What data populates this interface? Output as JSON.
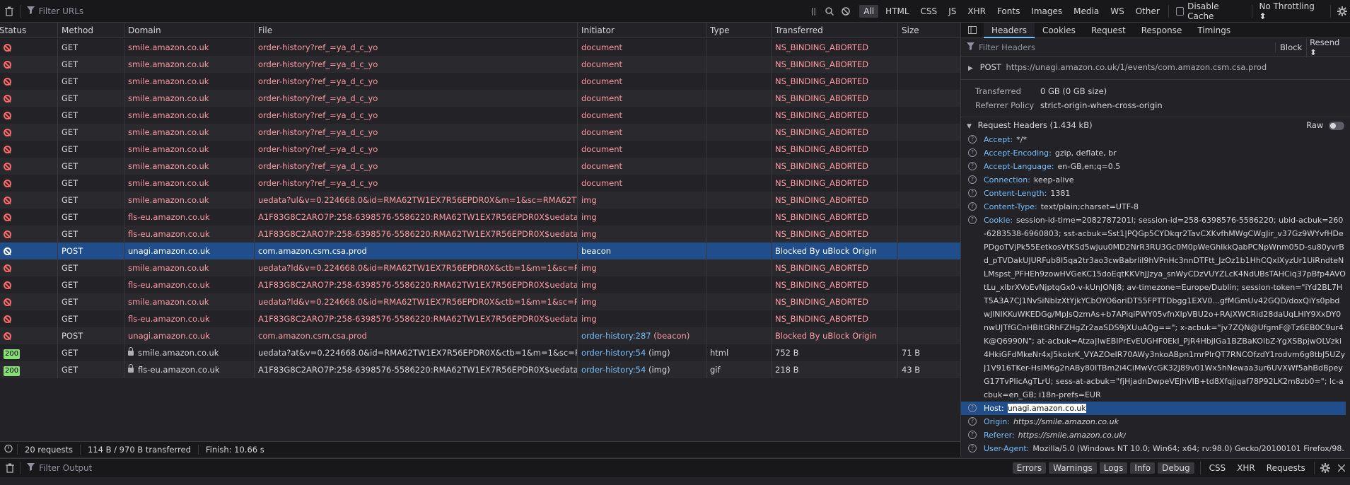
{
  "toolbar": {
    "filter_placeholder": "Filter URLs",
    "types": [
      "All",
      "HTML",
      "CSS",
      "JS",
      "XHR",
      "Fonts",
      "Images",
      "Media",
      "WS",
      "Other"
    ],
    "disable_cache": "Disable Cache",
    "throttling": "No Throttling ⬍",
    "pause_glyph": "||"
  },
  "columns": [
    "Status",
    "Method",
    "Domain",
    "File",
    "Initiator",
    "Type",
    "Transferred",
    "Size"
  ],
  "rows": [
    {
      "status": "blocked",
      "method": "GET",
      "lock": false,
      "domain": "smile.amazon.co.uk",
      "file": "order-history?ref_=ya_d_c_yo",
      "initiator": "document",
      "init_suffix": "",
      "init_link": false,
      "type": "",
      "transferred": "NS_BINDING_ABORTED",
      "size": "",
      "sel": false
    },
    {
      "status": "blocked",
      "method": "GET",
      "lock": false,
      "domain": "smile.amazon.co.uk",
      "file": "order-history?ref_=ya_d_c_yo",
      "initiator": "document",
      "init_suffix": "",
      "init_link": false,
      "type": "",
      "transferred": "NS_BINDING_ABORTED",
      "size": "",
      "sel": false
    },
    {
      "status": "blocked",
      "method": "GET",
      "lock": false,
      "domain": "smile.amazon.co.uk",
      "file": "order-history?ref_=ya_d_c_yo",
      "initiator": "document",
      "init_suffix": "",
      "init_link": false,
      "type": "",
      "transferred": "NS_BINDING_ABORTED",
      "size": "",
      "sel": false
    },
    {
      "status": "blocked",
      "method": "GET",
      "lock": false,
      "domain": "smile.amazon.co.uk",
      "file": "order-history?ref_=ya_d_c_yo",
      "initiator": "document",
      "init_suffix": "",
      "init_link": false,
      "type": "",
      "transferred": "NS_BINDING_ABORTED",
      "size": "",
      "sel": false
    },
    {
      "status": "blocked",
      "method": "GET",
      "lock": false,
      "domain": "smile.amazon.co.uk",
      "file": "order-history?ref_=ya_d_c_yo",
      "initiator": "document",
      "init_suffix": "",
      "init_link": false,
      "type": "",
      "transferred": "NS_BINDING_ABORTED",
      "size": "",
      "sel": false
    },
    {
      "status": "blocked",
      "method": "GET",
      "lock": false,
      "domain": "smile.amazon.co.uk",
      "file": "order-history?ref_=ya_d_c_yo",
      "initiator": "document",
      "init_suffix": "",
      "init_link": false,
      "type": "",
      "transferred": "NS_BINDING_ABORTED",
      "size": "",
      "sel": false
    },
    {
      "status": "blocked",
      "method": "GET",
      "lock": false,
      "domain": "smile.amazon.co.uk",
      "file": "order-history?ref_=ya_d_c_yo",
      "initiator": "document",
      "init_suffix": "",
      "init_link": false,
      "type": "",
      "transferred": "NS_BINDING_ABORTED",
      "size": "",
      "sel": false
    },
    {
      "status": "blocked",
      "method": "GET",
      "lock": false,
      "domain": "smile.amazon.co.uk",
      "file": "order-history?ref_=ya_d_c_yo",
      "initiator": "document",
      "init_suffix": "",
      "init_link": false,
      "type": "",
      "transferred": "NS_BINDING_ABORTED",
      "size": "",
      "sel": false
    },
    {
      "status": "blocked",
      "method": "GET",
      "lock": false,
      "domain": "smile.amazon.co.uk",
      "file": "order-history?ref_=ya_d_c_yo",
      "initiator": "document",
      "init_suffix": "",
      "init_link": false,
      "type": "",
      "transferred": "NS_BINDING_ABORTED",
      "size": "",
      "sel": false
    },
    {
      "status": "blocked",
      "method": "GET",
      "lock": false,
      "domain": "smile.amazon.co.uk",
      "file": "uedata?ul&v=0.224668.0&id=RMA62TW1EX7R56EPDR0X&m=1&sc=RMA62TW1EX7R56E",
      "initiator": "img",
      "init_suffix": "",
      "init_link": false,
      "type": "",
      "transferred": "NS_BINDING_ABORTED",
      "size": "",
      "sel": false
    },
    {
      "status": "blocked",
      "method": "GET",
      "lock": false,
      "domain": "fls-eu.amazon.co.uk",
      "file": "A1F83G8C2ARO7P:258-6398576-5586220:RMA62TW1EX7R56EPDR0X$uedata=s:/rd/uedat",
      "initiator": "img",
      "init_suffix": "",
      "init_link": false,
      "type": "",
      "transferred": "NS_BINDING_ABORTED",
      "size": "",
      "sel": false
    },
    {
      "status": "blocked",
      "method": "GET",
      "lock": false,
      "domain": "fls-eu.amazon.co.uk",
      "file": "A1F83G8C2ARO7P:258-6398576-5586220:RMA62TW1EX7R56EPDR0X$uedata=s:/rd/uedat",
      "initiator": "img",
      "init_suffix": "",
      "init_link": false,
      "type": "",
      "transferred": "NS_BINDING_ABORTED",
      "size": "",
      "sel": false
    },
    {
      "status": "blocked",
      "method": "POST",
      "lock": false,
      "domain": "unagi.amazon.co.uk",
      "file": "com.amazon.csm.csa.prod",
      "initiator": "beacon",
      "init_suffix": "",
      "init_link": false,
      "type": "",
      "transferred": "Blocked By uBlock Origin",
      "size": "",
      "sel": true
    },
    {
      "status": "blocked",
      "method": "GET",
      "lock": false,
      "domain": "smile.amazon.co.uk",
      "file": "uedata?ld&v=0.224668.0&id=RMA62TW1EX7R56EPDR0X&ctb=1&m=1&sc=RMA62TW1E",
      "initiator": "img",
      "init_suffix": "",
      "init_link": false,
      "type": "",
      "transferred": "NS_BINDING_ABORTED",
      "size": "",
      "sel": false
    },
    {
      "status": "blocked",
      "method": "GET",
      "lock": false,
      "domain": "fls-eu.amazon.co.uk",
      "file": "A1F83G8C2ARO7P:258-6398576-5586220:RMA62TW1EX7R56EPDR0X$uedata=s:/rd/uedat",
      "initiator": "img",
      "init_suffix": "",
      "init_link": false,
      "type": "",
      "transferred": "NS_BINDING_ABORTED",
      "size": "",
      "sel": false
    },
    {
      "status": "blocked",
      "method": "GET",
      "lock": false,
      "domain": "smile.amazon.co.uk",
      "file": "uedata?ld&v=0.224668.0&id=RMA62TW1EX7R56EPDR0X&ctb=1&m=1&sc=RMA62TW1E",
      "initiator": "img",
      "init_suffix": "",
      "init_link": false,
      "type": "",
      "transferred": "NS_BINDING_ABORTED",
      "size": "",
      "sel": false
    },
    {
      "status": "blocked",
      "method": "GET",
      "lock": false,
      "domain": "fls-eu.amazon.co.uk",
      "file": "A1F83G8C2ARO7P:258-6398576-5586220:RMA62TW1EX7R56EPDR0X$uedata=s:/rd/uedat",
      "initiator": "img",
      "init_suffix": "",
      "init_link": false,
      "type": "",
      "transferred": "NS_BINDING_ABORTED",
      "size": "",
      "sel": false
    },
    {
      "status": "blocked",
      "method": "POST",
      "lock": false,
      "domain": "unagi.amazon.co.uk",
      "file": "com.amazon.csm.csa.prod",
      "initiator": "order-history:287",
      "init_suffix": " (beacon)",
      "init_link": true,
      "type": "",
      "transferred": "Blocked By uBlock Origin",
      "size": "",
      "sel": false
    },
    {
      "status": "200",
      "method": "GET",
      "lock": true,
      "domain": "smile.amazon.co.uk",
      "file": "uedata?at&v=0.224668.0&id=RMA62TW1EX7R56EPDR0X&ctb=1&m=1&sc=RMA62TW1E",
      "initiator": "order-history:54",
      "init_suffix": " (img)",
      "init_link": true,
      "type": "html",
      "transferred": "752 B",
      "size": "71 B",
      "sel": false
    },
    {
      "status": "200",
      "method": "GET",
      "lock": true,
      "domain": "fls-eu.amazon.co.uk",
      "file": "A1F83G8C2ARO7P:258-6398576-5586220:RMA62TW1EX7R56EPDR0X$uedata=s:/rd/uedat",
      "initiator": "order-history:54",
      "init_suffix": " (img)",
      "init_link": true,
      "type": "gif",
      "transferred": "218 B",
      "size": "43 B",
      "sel": false
    }
  ],
  "statusbar": {
    "requests": "20 requests",
    "transferred": "114 B / 970 B transferred",
    "finish": "Finish: 10.66 s"
  },
  "panel": {
    "tabs": [
      "Headers",
      "Cookies",
      "Request",
      "Response",
      "Timings"
    ],
    "filter_placeholder": "Filter Headers",
    "block": "Block",
    "resend": "Resend ⬍",
    "request_line_method": "POST",
    "request_line_url": "https://unagi.amazon.co.uk/1/events/com.amazon.csm.csa.prod",
    "transferred_key": "Transferred",
    "transferred_val": "0 GB (0 GB size)",
    "referrer_key": "Referrer Policy",
    "referrer_val": "strict-origin-when-cross-origin",
    "req_headers_title": "Request Headers (1.434 kB)",
    "raw": "Raw",
    "headers": [
      {
        "k": "Accept:",
        "v": "*/*",
        "it": false,
        "sel": false
      },
      {
        "k": "Accept-Encoding:",
        "v": "gzip, deflate, br",
        "it": false,
        "sel": false
      },
      {
        "k": "Accept-Language:",
        "v": "en-GB,en;q=0.5",
        "it": false,
        "sel": false
      },
      {
        "k": "Connection:",
        "v": "keep-alive",
        "it": false,
        "sel": false
      },
      {
        "k": "Content-Length:",
        "v": "1381",
        "it": false,
        "sel": false
      },
      {
        "k": "Content-Type:",
        "v": "text/plain;charset=UTF-8",
        "it": false,
        "sel": false
      },
      {
        "k": "Cookie:",
        "v": "session-id-time=2082787201l; session-id=258-6398576-5586220; ubid-acbuk=260-6283538-6960803; sst-acbuk=Sst1|PQGp5CYDkqr2TavCXKvfhMWgCWgJir_v37Gz9WYvfHDePDgoTVjPk55EetkosVtKSd5wjuu0MD2NrR3RU3Gc0M0pWeGhIkkQabPCNpWnm05D-su80yvrBd_pTVDakUJURFub8I5qa2tr3ao3cwBabrliI9hVPnHc3nnDTFtt_JzOz1b1HhCQxlXyzUr1UiRndteNLMspst_PFHEh9zowHVGeKC15doEqtKKVhJJzya_snWyCDzVUYZLcK4NdUBsTAHCiq37pBfp4AVOtLu_xlbrXVoEvNjptqGx0-v-kUnJONj8; av-timezone=Europe/Dublin; session-token=\"iYd2BL7HT5A3A7CJ1NvSiNbIzXtYjkYCbOYO6oriDT55FPTTDbgg1EXV0...gfMGmUv42GQD/doxQiYs0pbdwJlNIKKuWKEDGg/MpJsQzmAs+b7APiqiPWY05vfnXIpVBU2o+RAjXWCRid28daUqLHIY9XxDY0nwUJTfGCnHBltGRhFZHgZr2aaSDS9jXUuAQg==\"; x-acbuk=\"jv7ZQN@UfgmF@Tz6EB0C9ur4K@Q6990N\"; at-acbuk=Atza|IwEBIPrEvEUGHF0EkI_PjR4HbjIGa1BZBaKOlbZ-YgXSBpjwOLVzki4HkiGFdMkeNr4xJ5kokrK_VYAZOeIR70AWy3nkoABpn1mrPlrQT7RNCOfzdY1rodvm6g8tbJ5UZyJ1V916TKer-HsIM6g2nABy80ITBm2i4CiMwVcGK32J89v01Wx5hNewaa3ur6UVXWf5ahBdBpeyG17TvPIicAgTLrU; sess-at-acbuk=\"fjHjadnDwpeVEJhVIB+td8Xfqjjqaf78P92LK2m8zb0=\"; lc-acbuk=en_GB; i18n-prefs=EUR",
        "it": false,
        "sel": false
      },
      {
        "k": "Host:",
        "v": "unagi.amazon.co.uk",
        "it": false,
        "sel": true
      },
      {
        "k": "Origin:",
        "v": "https://smile.amazon.co.uk",
        "it": true,
        "sel": false
      },
      {
        "k": "Referer:",
        "v": "https://smile.amazon.co.uk/",
        "it": true,
        "sel": false
      },
      {
        "k": "User-Agent:",
        "v": "Mozilla/5.0 (Windows NT 10.0; Win64; x64; rv:98.0) Gecko/20100101 Firefox/98.0",
        "it": false,
        "sel": false
      }
    ]
  },
  "console": {
    "filter_placeholder": "Filter Output",
    "buttons": [
      "Errors",
      "Warnings",
      "Logs",
      "Info",
      "Debug"
    ],
    "types": [
      "CSS",
      "XHR",
      "Requests"
    ]
  },
  "colors": {
    "accent": "#75bfff",
    "selected": "#204e8a",
    "blocked": "#ff6b6b",
    "ok": "#86de74"
  }
}
